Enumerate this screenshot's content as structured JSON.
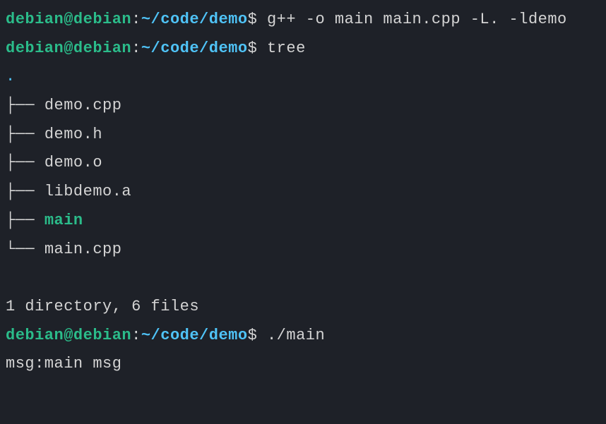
{
  "prompt": {
    "user_host": "debian@debian",
    "colon": ":",
    "path": "~/code/demo",
    "dollar": "$"
  },
  "commands": {
    "cmd1": "g++ -o main main.cpp -L. -ldemo",
    "cmd2": "tree",
    "cmd3": "./main"
  },
  "tree": {
    "root": ".",
    "branch_mid": "├── ",
    "branch_last": "└── ",
    "files": {
      "f1": "demo.cpp",
      "f2": "demo.h",
      "f3": "demo.o",
      "f4": "libdemo.a",
      "f5": "main",
      "f6": "main.cpp"
    },
    "summary": "1 directory, 6 files"
  },
  "output": {
    "main_output": "msg:main msg"
  }
}
